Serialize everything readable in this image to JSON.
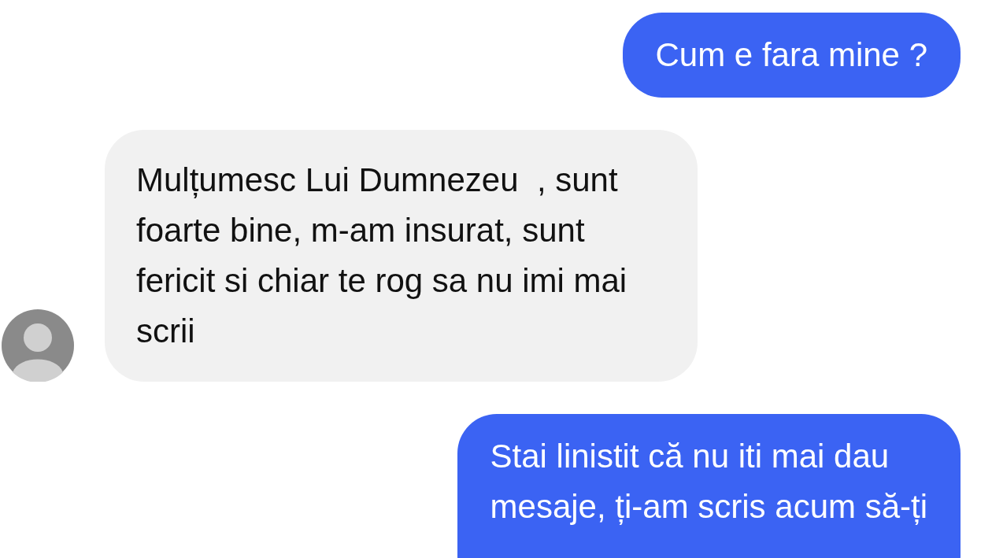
{
  "messages": [
    {
      "kind": "sent",
      "text": "Cum e fara mine ?"
    },
    {
      "kind": "received",
      "text": "Mulțumesc Lui Dumnezeu  , sunt\nfoarte bine, m-am insurat, sunt\nfericit si chiar te rog sa nu imi mai\nscrii"
    },
    {
      "kind": "sent",
      "text": "Stai linistit că nu iti mai dau\nmesaje, ți-am scris acum să-ți"
    }
  ]
}
